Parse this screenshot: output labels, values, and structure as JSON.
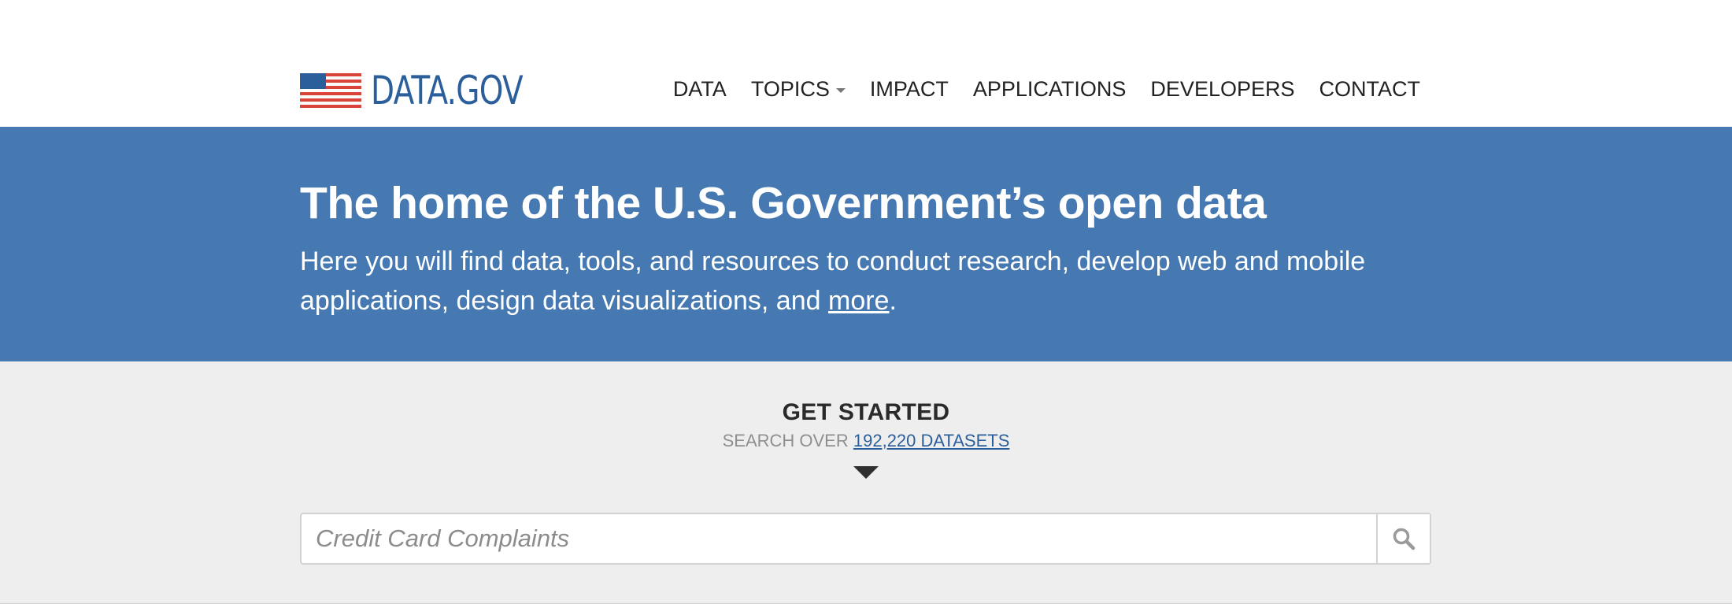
{
  "brand": {
    "logo_text": "DATA.GOV",
    "logo_color": "#2b5f9b"
  },
  "nav": {
    "items": [
      {
        "label": "DATA",
        "has_dropdown": false
      },
      {
        "label": "TOPICS",
        "has_dropdown": true
      },
      {
        "label": "IMPACT",
        "has_dropdown": false
      },
      {
        "label": "APPLICATIONS",
        "has_dropdown": false
      },
      {
        "label": "DEVELOPERS",
        "has_dropdown": false
      },
      {
        "label": "CONTACT",
        "has_dropdown": false
      }
    ]
  },
  "hero": {
    "title": "The home of the U.S. Government’s open data",
    "subtitle_before": "Here you will find data, tools, and resources to conduct research, develop web and mobile applications, design data visualizations, and ",
    "subtitle_link": "more",
    "subtitle_after": ".",
    "background_color": "#4679b2"
  },
  "get_started": {
    "title": "GET STARTED",
    "search_over_label": "SEARCH OVER",
    "datasets_link": "192,220 DATASETS"
  },
  "search": {
    "placeholder": "Credit Card Complaints",
    "value": "",
    "button_icon": "search-icon"
  }
}
